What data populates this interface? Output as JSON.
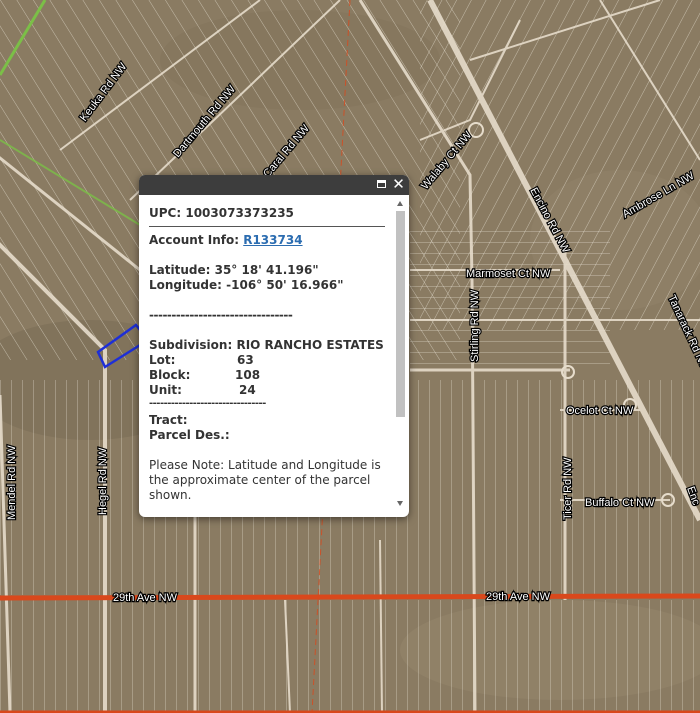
{
  "map": {
    "road_labels": [
      "Keuka Rd NW",
      "Dartmouth Rd NW",
      "Caral Rd NW",
      "Walaby Ct NW",
      "Encino Rd NW",
      "Ambrose Ln NW",
      "Marmoset Ct NW",
      "Tanarack Rd NW",
      "Stirling Rd NW",
      "Ocelot Ct NW",
      "Ticer Rd NW",
      "Buffalo Ct NW",
      "Mendel Rd NW",
      "Hegel Rd NW",
      "29th Ave NW",
      "29th Ave NW",
      "Enc"
    ],
    "colors": {
      "imagery": "#8a7b62",
      "parcel_lines": "#f0ece2",
      "major_road": "#d9481c",
      "selected_parcel": "#1e2fd6",
      "green_road": "#7bbf47"
    }
  },
  "popup": {
    "upc_label": "UPC:",
    "upc_value": "1003073373235",
    "account_label": "Account Info:",
    "account_link": "R133734",
    "latitude_label": "Latitude:",
    "latitude_value": "35° 18' 41.196\"",
    "longitude_label": "Longitude:",
    "longitude_value": "-106° 50' 16.966\"",
    "separator": "--------------------------------",
    "subdivision_label": "Subdivision:",
    "subdivision_value": "RIO RANCHO ESTATES",
    "lot_label": "Lot:",
    "lot_value": "63",
    "block_label": "Block:",
    "block_value": "108",
    "unit_label": "Unit:",
    "unit_value": "24",
    "tract_label": "Tract:",
    "parcel_label": "Parcel Des.:",
    "note": "Please Note: Latitude and Longitude is the approximate center of the parcel shown."
  }
}
